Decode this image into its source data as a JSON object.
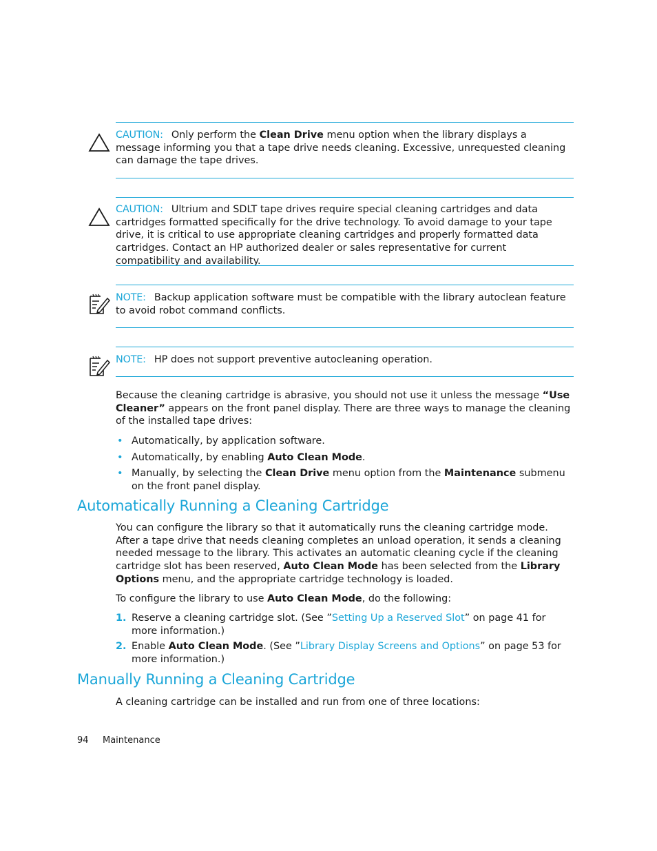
{
  "notices": [
    {
      "type": "caution",
      "icon": "caution-triangle-icon",
      "label": "CAUTION:",
      "segments": [
        {
          "text": "Only perform the ",
          "bold": false
        },
        {
          "text": "Clean Drive",
          "bold": true
        },
        {
          "text": " menu option when the library displays a message informing you that a tape drive needs cleaning. Excessive, unrequested cleaning can damage the tape drives.",
          "bold": false
        }
      ]
    },
    {
      "type": "caution",
      "icon": "caution-triangle-icon",
      "label": "CAUTION:",
      "segments": [
        {
          "text": "Ultrium and SDLT tape drives require special cleaning cartridges and data cartridges formatted specifically for the drive technology. To avoid damage to your tape drive, it is critical to use appropriate cleaning cartridges and properly formatted data cartridges. Contact an HP authorized dealer or sales representative for current compatibility and availability.",
          "bold": false
        }
      ]
    },
    {
      "type": "note",
      "icon": "note-pencil-icon",
      "label": "NOTE:",
      "segments": [
        {
          "text": "Backup application software must be compatible with the library autoclean feature to avoid robot command conflicts.",
          "bold": false
        }
      ]
    },
    {
      "type": "note",
      "icon": "note-pencil-icon",
      "label": "NOTE:",
      "segments": [
        {
          "text": "HP does not support preventive autocleaning operation.",
          "bold": false
        }
      ]
    }
  ],
  "intro": {
    "segments": [
      {
        "text": "Because the cleaning cartridge is abrasive, you should not use it unless the message ",
        "bold": false
      },
      {
        "text": "“Use Cleaner”",
        "bold": true
      },
      {
        "text": " appears on the front panel display. There are three ways to manage the cleaning of the installed tape drives:",
        "bold": false
      }
    ],
    "bullets": [
      [
        {
          "text": "Automatically, by application software.",
          "bold": false
        }
      ],
      [
        {
          "text": "Automatically, by enabling ",
          "bold": false
        },
        {
          "text": "Auto Clean Mode",
          "bold": true
        },
        {
          "text": ".",
          "bold": false
        }
      ],
      [
        {
          "text": "Manually, by selecting the ",
          "bold": false
        },
        {
          "text": "Clean Drive",
          "bold": true
        },
        {
          "text": " menu option from the ",
          "bold": false
        },
        {
          "text": "Maintenance",
          "bold": true
        },
        {
          "text": " submenu on the front panel display.",
          "bold": false
        }
      ]
    ]
  },
  "section_auto": {
    "heading": "Automatically Running a Cleaning Cartridge",
    "paragraph": [
      {
        "text": "You can configure the library so that it automatically runs the cleaning cartridge mode. After a tape drive that needs cleaning completes an unload operation, it sends a cleaning needed message to the library. This activates an automatic cleaning cycle if the cleaning cartridge slot has been reserved, ",
        "bold": false
      },
      {
        "text": "Auto Clean Mode",
        "bold": true
      },
      {
        "text": " has been selected from the ",
        "bold": false
      },
      {
        "text": "Library Options",
        "bold": true
      },
      {
        "text": " menu, and the appropriate cartridge technology is loaded.",
        "bold": false
      }
    ],
    "configure": [
      {
        "text": "To configure the library to use ",
        "bold": false
      },
      {
        "text": "Auto Clean Mode",
        "bold": true
      },
      {
        "text": ", do the following:",
        "bold": false
      }
    ],
    "steps": [
      {
        "num": "1.",
        "segments": [
          {
            "text": "Reserve a cleaning cartridge slot. (See ”",
            "bold": false
          },
          {
            "text": "Setting Up a Reserved Slot",
            "link": true
          },
          {
            "text": "” on page 41 for more information.)",
            "bold": false
          }
        ]
      },
      {
        "num": "2.",
        "segments": [
          {
            "text": "Enable ",
            "bold": false
          },
          {
            "text": "Auto Clean Mode",
            "bold": true
          },
          {
            "text": ". (See ”",
            "bold": false
          },
          {
            "text": "Library Display Screens and Options",
            "link": true
          },
          {
            "text": "” on page 53 for more information.)",
            "bold": false
          }
        ]
      }
    ]
  },
  "section_manual": {
    "heading": "Manually Running a Cleaning Cartridge",
    "paragraph": "A cleaning cartridge can be installed and run from one of three locations:"
  },
  "footer": {
    "page_number": "94",
    "section": "Maintenance"
  },
  "colors": {
    "accent": "#1ba6d8",
    "text": "#1a1a1a"
  }
}
